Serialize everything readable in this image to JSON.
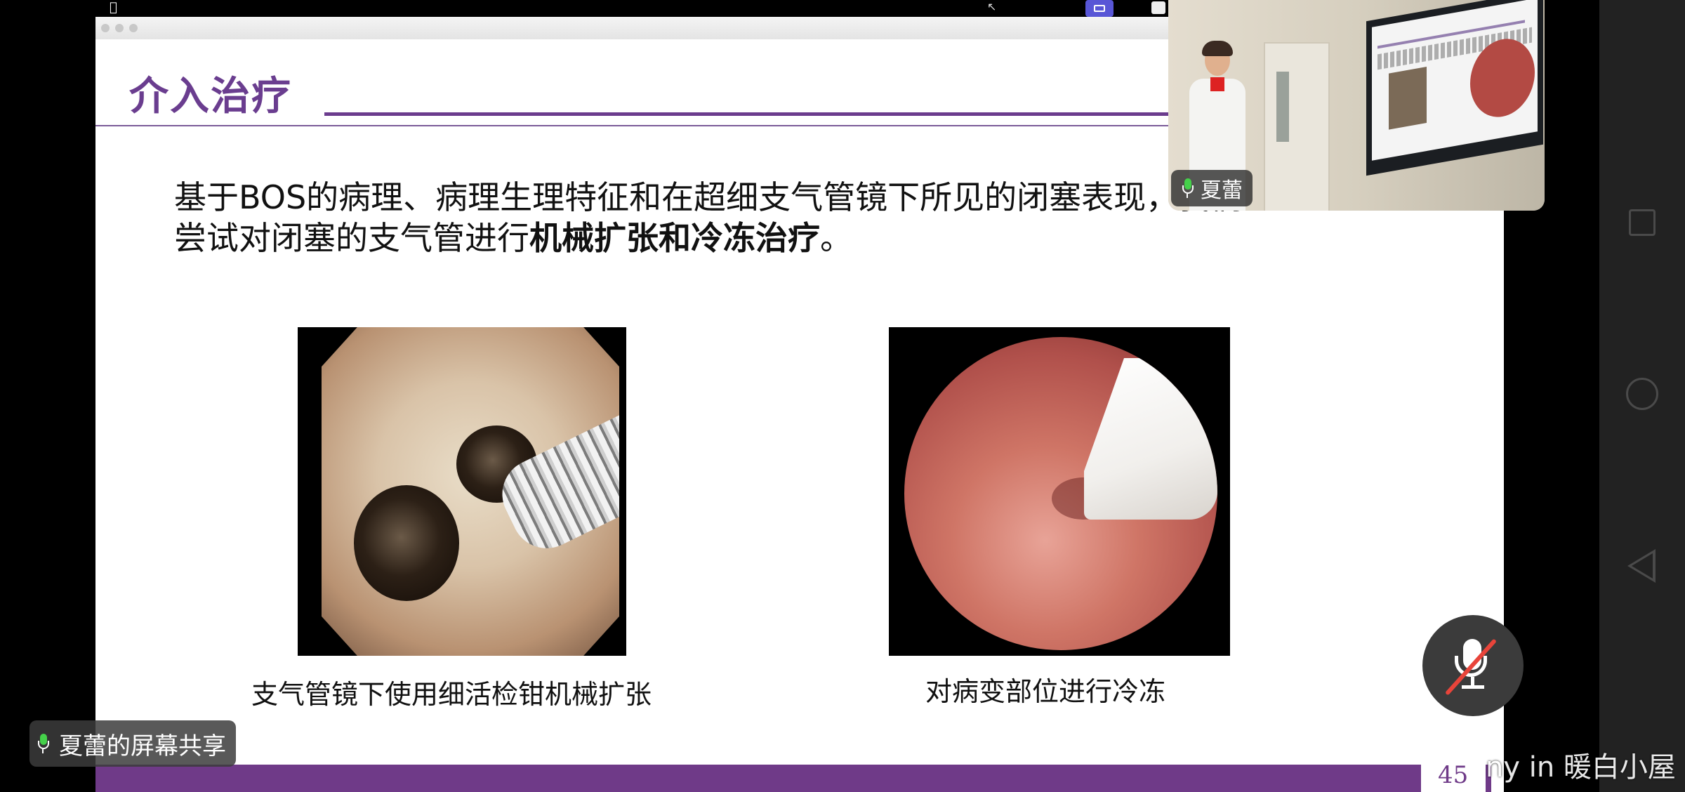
{
  "slide": {
    "title": "介入治疗",
    "body_line1": "基于BOS的病理、病理生理特征和在超细支气管镜下所见的闭塞表现，我们",
    "body_line2_prefix": "尝试对闭塞的支气管进行",
    "body_line2_bold": "机械扩张和冷冻治疗",
    "body_line2_suffix": "。",
    "caption_left": "支气管镜下使用细活检钳机械扩张",
    "caption_right": "对病变部位进行冷冻",
    "page_number": "45",
    "colors": {
      "accent": "#6f3a88",
      "title": "#6a3d8f"
    }
  },
  "video_pip": {
    "speaker_name": "夏蕾",
    "mic_active": true
  },
  "share_chip": {
    "label": "夏蕾的屏幕共享"
  },
  "mic_button": {
    "state": "muted",
    "icon": "mic-muted-icon"
  },
  "watermark": {
    "text": "ny in 暖白小屋"
  },
  "android_nav": {
    "icons": [
      "recents-square-icon",
      "home-circle-icon",
      "back-triangle-icon"
    ]
  },
  "mac_menubar": {
    "icons": [
      "apple-icon",
      "cursor-icon",
      "screen-share-icon",
      "app-icon"
    ]
  }
}
